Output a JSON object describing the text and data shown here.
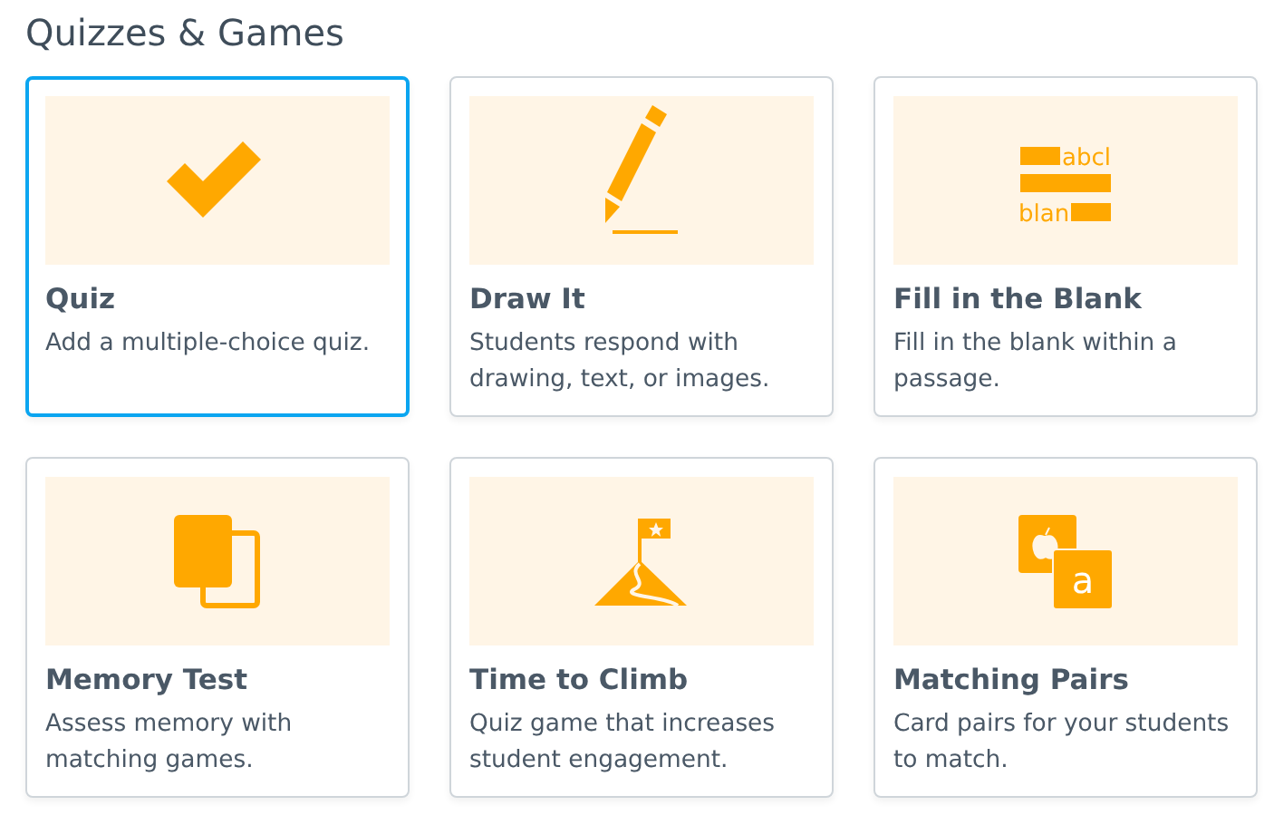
{
  "heading": "Quizzes & Games",
  "cards": [
    {
      "kind": "check",
      "title": "Quiz",
      "description": "Add a multiple-choice quiz.",
      "selected": true
    },
    {
      "kind": "pencil",
      "title": "Draw It",
      "description": "Students respond with drawing, text, or images.",
      "selected": false
    },
    {
      "kind": "blanks",
      "title": "Fill in the Blank",
      "description": "Fill in the blank within a passage.",
      "selected": false,
      "icon_texts": [
        "abcl",
        "blan"
      ]
    },
    {
      "kind": "cards",
      "title": "Memory Test",
      "description": "Assess memory with matching games.",
      "selected": false
    },
    {
      "kind": "mountain",
      "title": "Time to Climb",
      "description": "Quiz game that increases student engagement.",
      "selected": false
    },
    {
      "kind": "pairs",
      "title": "Matching Pairs",
      "description": "Card pairs for your students to match.",
      "selected": false,
      "icon_texts": [
        "a"
      ]
    }
  ]
}
